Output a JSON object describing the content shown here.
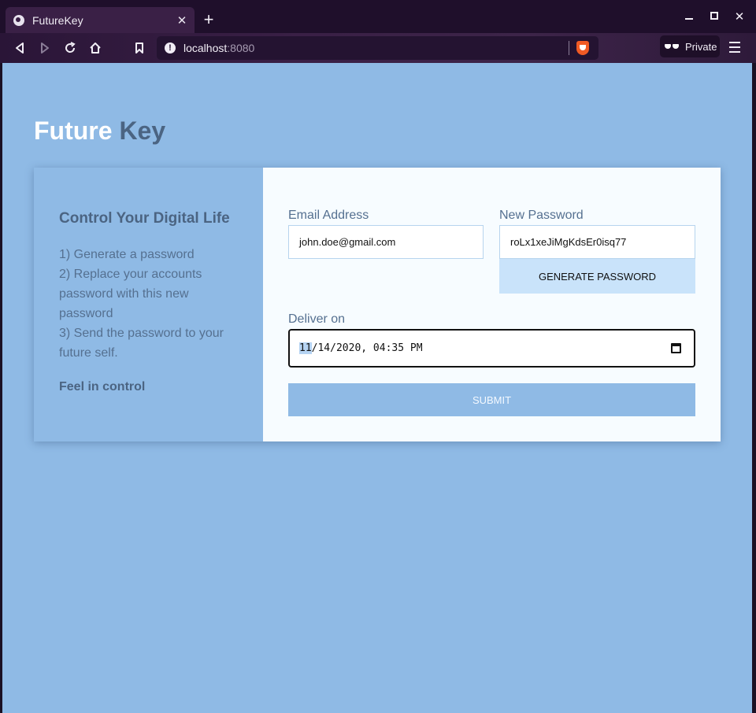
{
  "browser": {
    "tab_title": "FutureKey",
    "tab_close_glyph": "✕",
    "new_tab_glyph": "+",
    "url_host": "localhost",
    "url_port": ":8080",
    "url_info_glyph": "!",
    "private_label": "Private",
    "window_close_glyph": "✕",
    "icons": {
      "back": "back-icon",
      "forward": "forward-icon",
      "reload": "reload-icon",
      "home": "home-icon",
      "bookmark": "bookmark-icon",
      "brave": "brave-shield-icon",
      "private": "private-glasses-icon",
      "menu": "hamburger-menu-icon"
    },
    "colors": {
      "tab_bar": "#1f0f2b",
      "toolbar": "#3a2046",
      "brave_orange": "#f05a24"
    }
  },
  "page": {
    "title_part1": "Future",
    "title_part2": " Key",
    "colors": {
      "background": "#8fbae5",
      "title_dark": "#4b6482",
      "form_bg": "#f7fcff",
      "generate_bg": "#c9e3fa"
    }
  },
  "info_panel": {
    "heading": "Control Your Digital Life",
    "steps": [
      "1) Generate a password",
      "2) Replace your accounts password with this new password",
      "3) Send the password to your future self."
    ],
    "footer": "Feel in control"
  },
  "form": {
    "email_label": "Email Address",
    "email_value": "john.doe@gmail.com",
    "password_label": "New Password",
    "password_value": "roLx1xeJiMgKdsEr0isq77",
    "generate_label": "GENERATE PASSWORD",
    "deliver_label": "Deliver on",
    "deliver": {
      "month": "11",
      "rest": "/14/2020, 04:35 PM"
    },
    "calendar_icon": "calendar-icon",
    "submit_label": "SUBMIT"
  }
}
